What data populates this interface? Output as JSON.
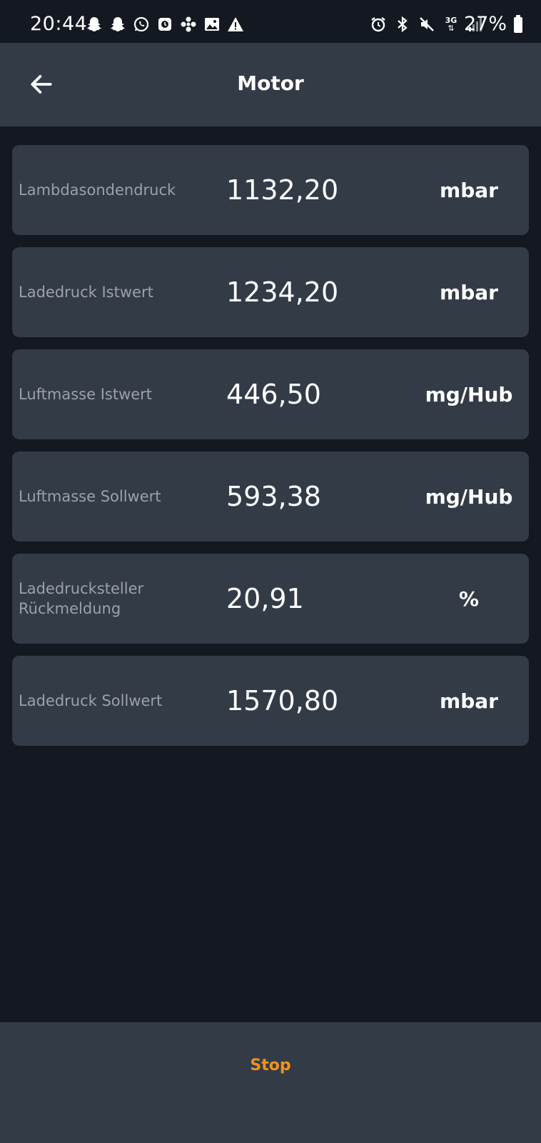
{
  "status_bar": {
    "time": "20:44",
    "battery_percent": "27%",
    "left_icons": [
      "snapchat-icon",
      "snapchat-icon",
      "whatsapp-icon",
      "screen-record-icon",
      "fan-icon",
      "image-icon",
      "warning-icon"
    ],
    "right_icons": [
      "alarm-icon",
      "bluetooth-icon",
      "mute-icon",
      "3g-data-icon",
      "signal-icon",
      "battery-icon"
    ],
    "network_label": "3G"
  },
  "app_bar": {
    "title": "Motor",
    "back_icon": "arrow-left-icon"
  },
  "readings": [
    {
      "label": "Lambdasondendruck",
      "value": "1132,20",
      "unit": "mbar"
    },
    {
      "label": "Ladedruck Istwert",
      "value": "1234,20",
      "unit": "mbar"
    },
    {
      "label": "Luftmasse Istwert",
      "value": "446,50",
      "unit": "mg/Hub"
    },
    {
      "label": "Luftmasse Sollwert",
      "value": "593,38",
      "unit": "mg/Hub"
    },
    {
      "label": "Ladedrucksteller Rückmeldung",
      "value": "20,91",
      "unit": "%"
    },
    {
      "label": "Ladedruck Sollwert",
      "value": "1570,80",
      "unit": "mbar"
    }
  ],
  "bottom_bar": {
    "stop_label": "Stop"
  },
  "colors": {
    "background": "#141821",
    "card": "#333b47",
    "label": "#9aa1ad",
    "accent": "#f0921e"
  }
}
